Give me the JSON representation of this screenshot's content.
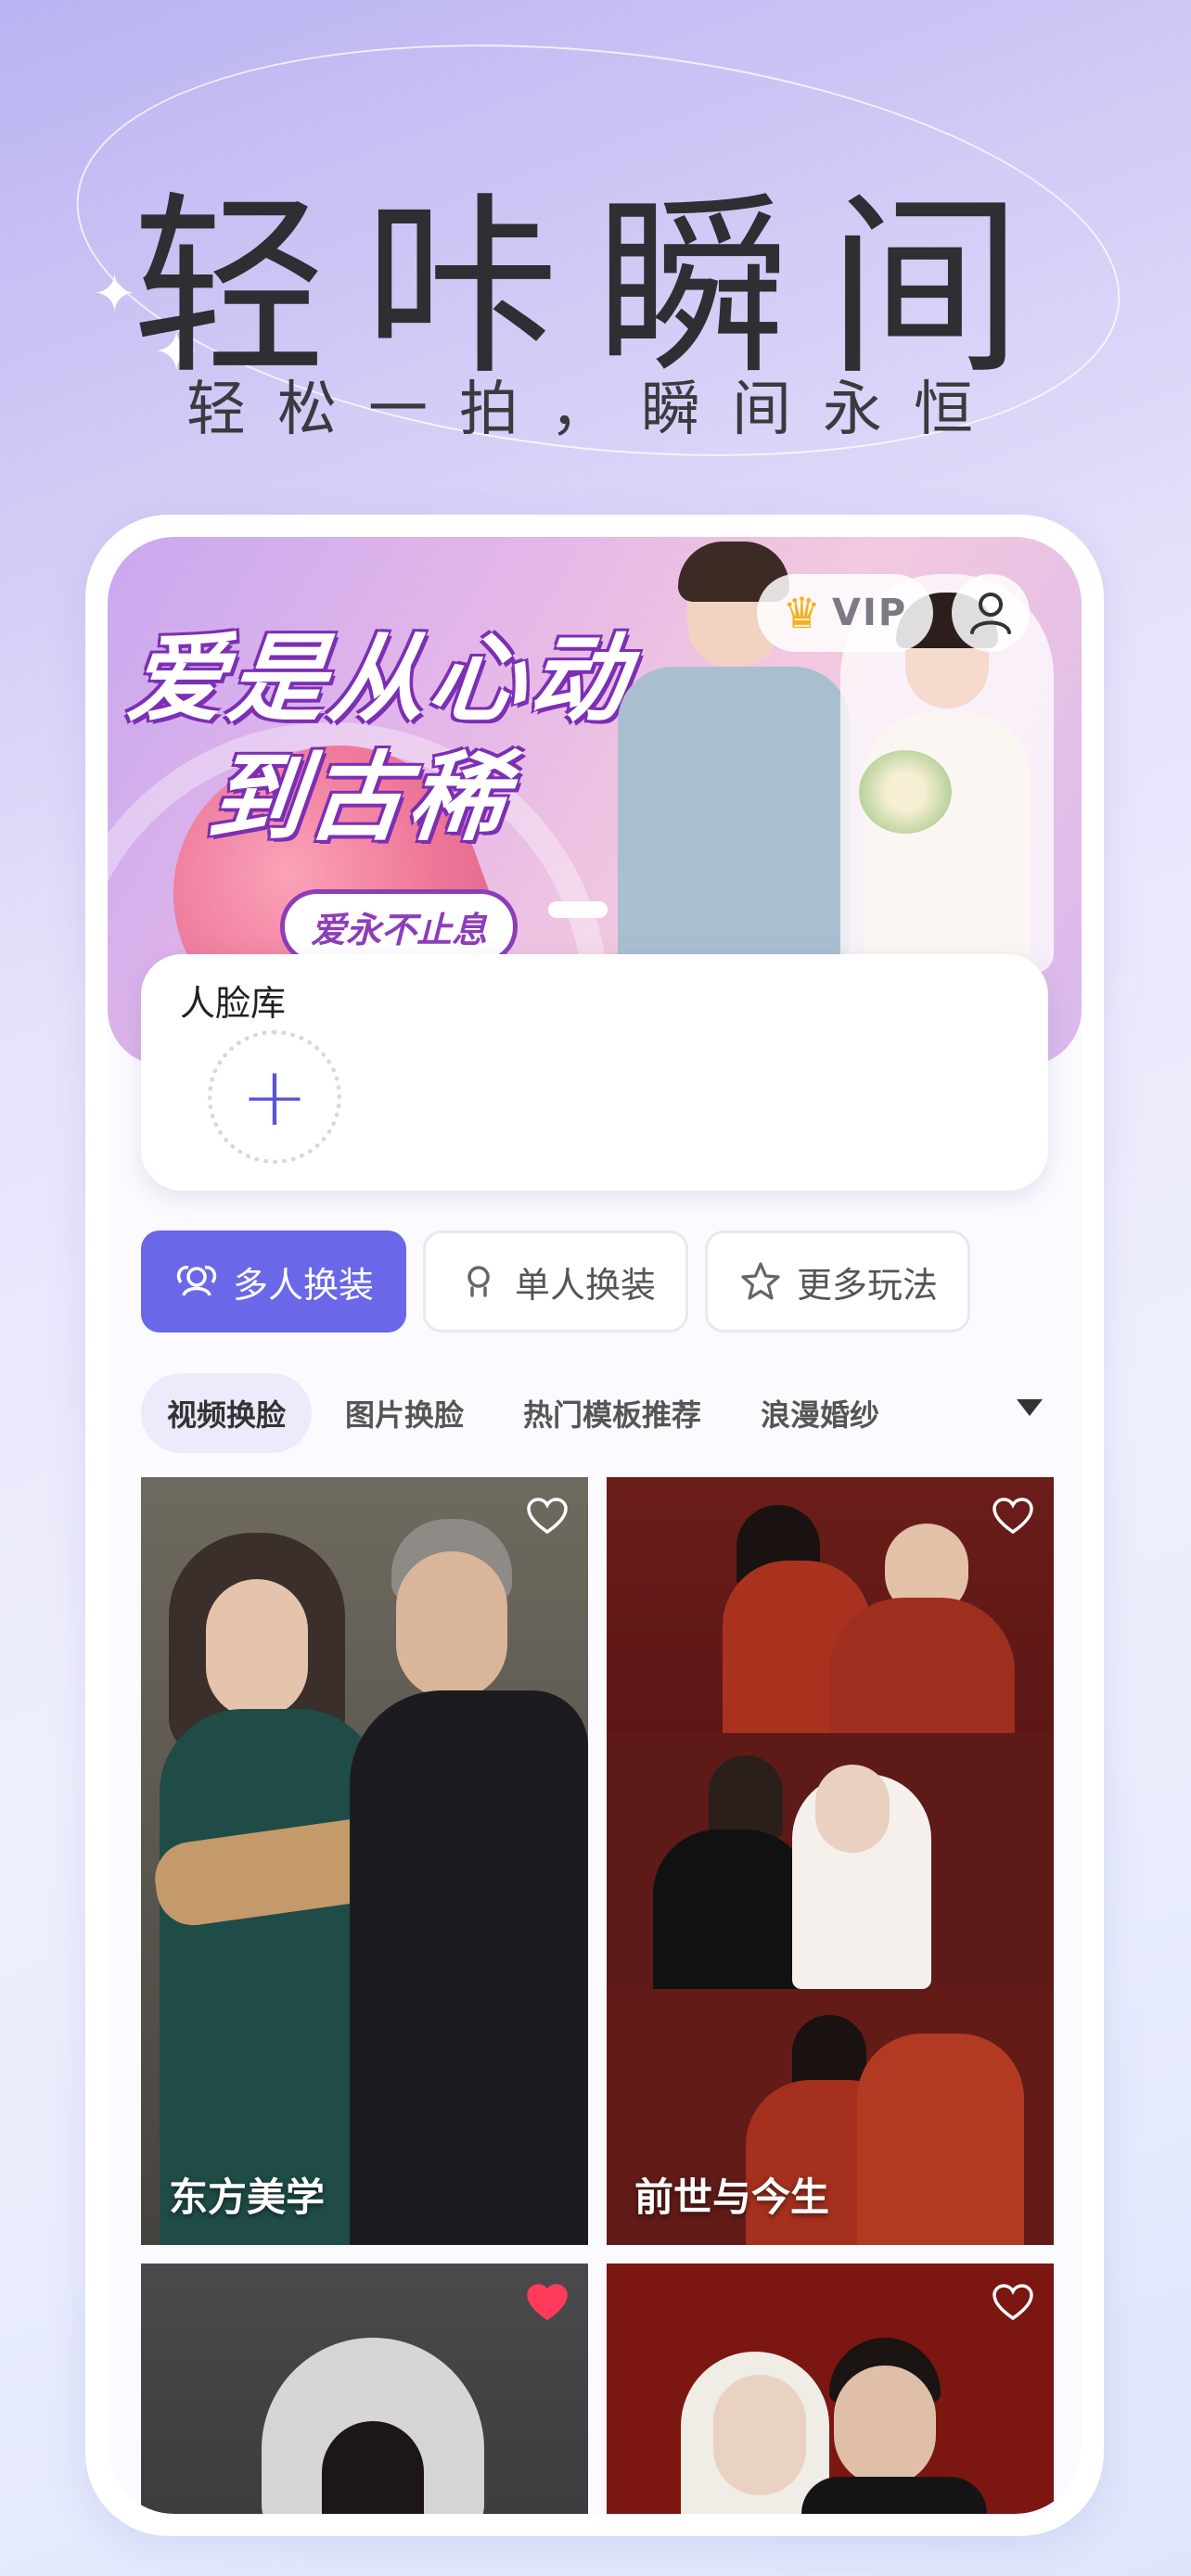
{
  "hero": {
    "title": "轻咔瞬间",
    "subtitle": "轻松一拍，瞬间永恒"
  },
  "banner": {
    "slogan_line1": "爱是从心动",
    "slogan_line2": "到古稀",
    "tag": "爱永不止息",
    "vip_label": "VIP",
    "crown_icon": "crown-icon",
    "user_icon": "user-icon"
  },
  "face_library": {
    "title": "人脸库",
    "add_symbol": "+"
  },
  "modes": [
    {
      "label": "多人换装",
      "icon": "group-icon",
      "active": true
    },
    {
      "label": "单人换装",
      "icon": "person-icon",
      "active": false
    },
    {
      "label": "更多玩法",
      "icon": "star-icon",
      "active": false
    }
  ],
  "tabs": [
    {
      "label": "视频换脸",
      "active": true
    },
    {
      "label": "图片换脸",
      "active": false
    },
    {
      "label": "热门模板推荐",
      "active": false
    },
    {
      "label": "浪漫婚纱",
      "active": false
    }
  ],
  "grid": [
    {
      "label": "东方美学",
      "liked": false
    },
    {
      "label": "前世与今生",
      "liked": false
    },
    {
      "label": "",
      "liked": true
    },
    {
      "label": "",
      "liked": false
    }
  ],
  "colors": {
    "accent": "#6a67e8",
    "like_active": "#ff3b5c"
  }
}
